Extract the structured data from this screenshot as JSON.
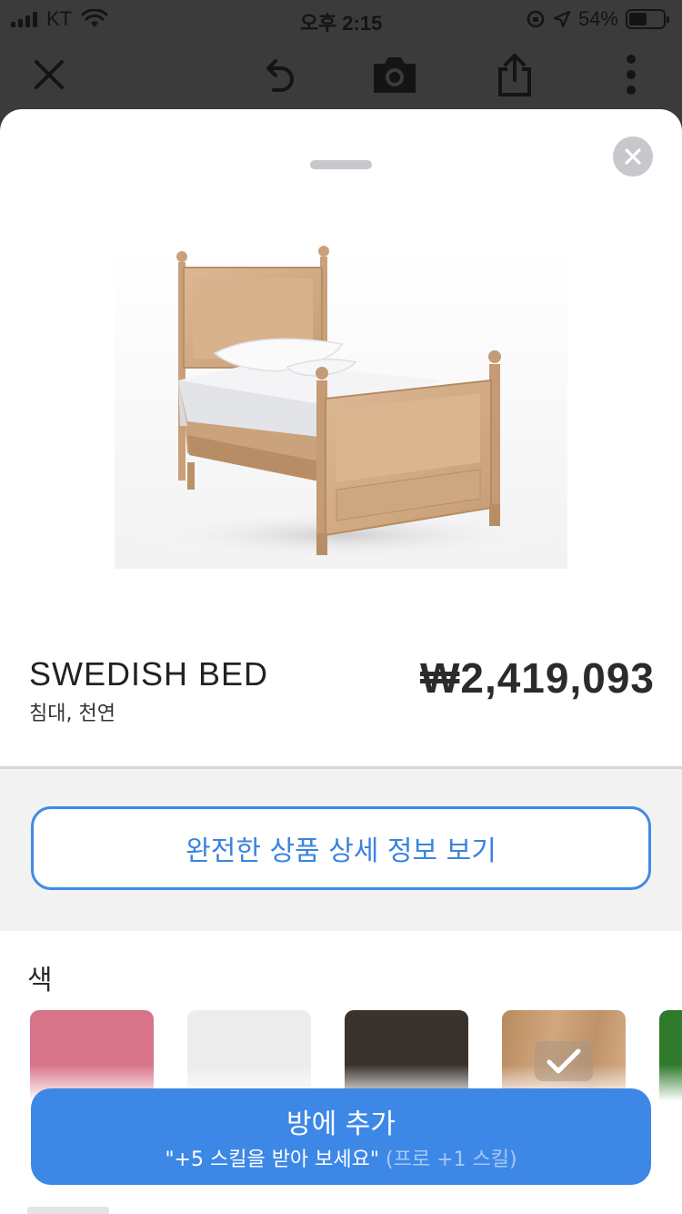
{
  "status_bar": {
    "carrier": "KT",
    "time": "오후 2:15",
    "battery_percent": "54%",
    "battery_level": 0.54
  },
  "toolbar": {
    "icons": [
      "close-icon",
      "undo-icon",
      "camera-icon",
      "share-icon",
      "more-vertical-icon"
    ]
  },
  "sheet": {
    "close_icon": "close-icon"
  },
  "product": {
    "name": "SWEDISH BED",
    "category": "침대, 천연",
    "price": "₩2,419,093"
  },
  "details_button": {
    "label": "완전한 상품 상세 정보 보기"
  },
  "colors": {
    "heading": "색",
    "swatches": [
      {
        "name": "pink",
        "color": "#d77489",
        "selected": false
      },
      {
        "name": "white",
        "color": "#ececec",
        "selected": false
      },
      {
        "name": "dark-brown",
        "color": "#3a322c",
        "selected": false
      },
      {
        "name": "natural-wood",
        "color": "#c69c74",
        "selected": true
      },
      {
        "name": "green",
        "color": "#2f7a2a",
        "selected": false
      }
    ]
  },
  "add_button": {
    "label": "방에 추가",
    "promo": "\"+5 스킬을 받아 보세요\"",
    "promo_note": "(프로 +1 스킬)"
  },
  "accent_color": "#3d88e6"
}
